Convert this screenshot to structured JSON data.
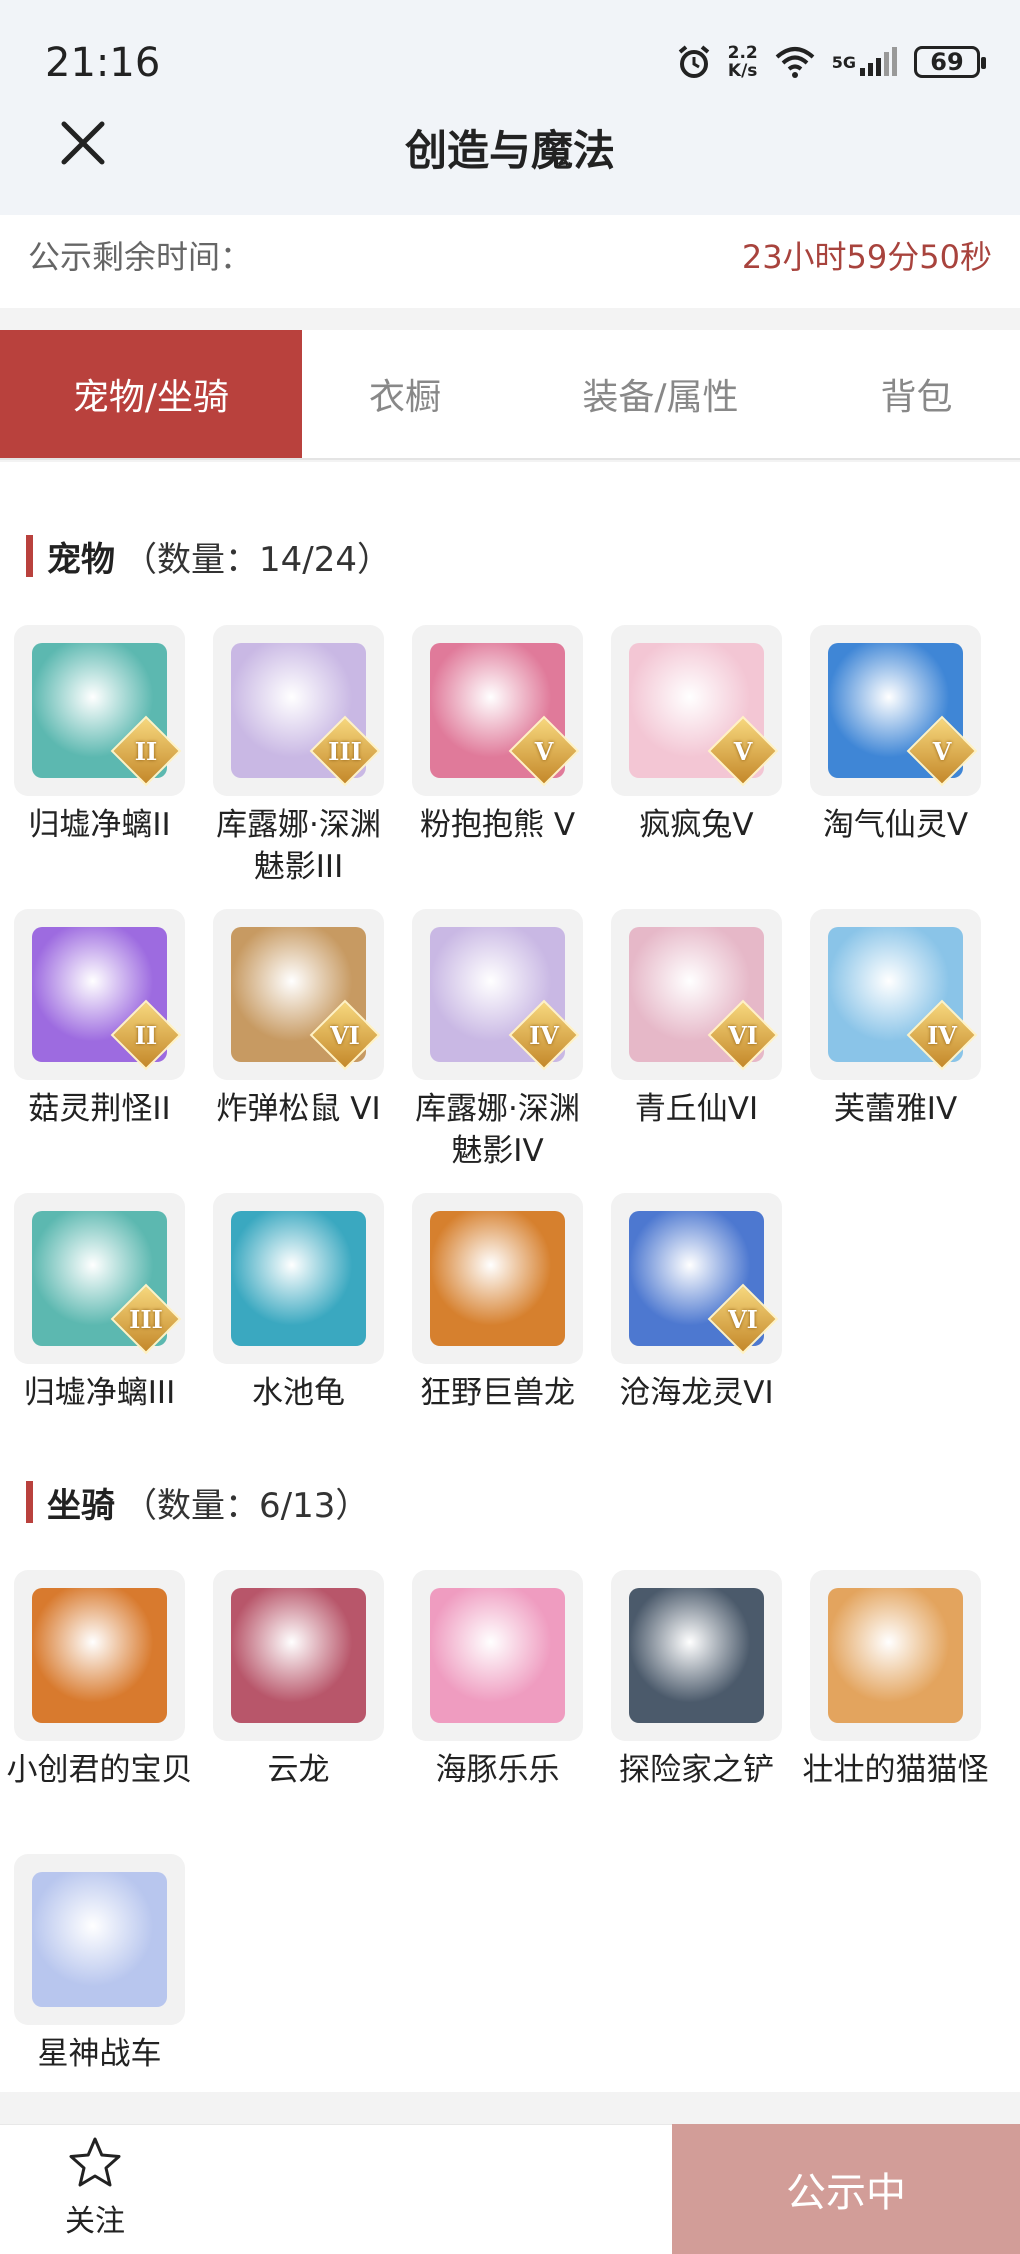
{
  "status_bar": {
    "time": "21:16",
    "net_speed_value": "2.2",
    "net_speed_unit": "K/s",
    "network": "5G",
    "battery": "69"
  },
  "header": {
    "title": "创造与魔法"
  },
  "notice": {
    "label": "公示剩余时间：",
    "remaining": "23小时59分50秒"
  },
  "tabs": [
    {
      "label": "宠物/坐骑",
      "active": true
    },
    {
      "label": "衣橱",
      "active": false
    },
    {
      "label": "装备/属性",
      "active": false
    },
    {
      "label": "背包",
      "active": false
    }
  ],
  "pets": {
    "title": "宠物",
    "count": "（数量：14/24）",
    "items": [
      {
        "name": "归墟净螭II",
        "rank": "II",
        "color": "#5cb8b0"
      },
      {
        "name": "库露娜·深渊魅影III",
        "rank": "III",
        "color": "#c9b8e4"
      },
      {
        "name": "粉抱抱熊 V",
        "rank": "V",
        "color": "#e07a9a"
      },
      {
        "name": "疯疯兔V",
        "rank": "V",
        "color": "#f3c6d4"
      },
      {
        "name": "淘气仙灵V",
        "rank": "V",
        "color": "#3f86d6"
      },
      {
        "name": "菇灵荆怪II",
        "rank": "II",
        "color": "#9d6be0"
      },
      {
        "name": "炸弹松鼠 VI",
        "rank": "VI",
        "color": "#c79a62"
      },
      {
        "name": "库露娜·深渊魅影IV",
        "rank": "IV",
        "color": "#c9b8e4"
      },
      {
        "name": "青丘仙VI",
        "rank": "VI",
        "color": "#e6b8c8"
      },
      {
        "name": "芙蕾雅IV",
        "rank": "IV",
        "color": "#8ac4e8"
      },
      {
        "name": "归墟净螭III",
        "rank": "III",
        "color": "#5cb8b0"
      },
      {
        "name": "水池龟",
        "rank": "",
        "color": "#3aa8c0"
      },
      {
        "name": "狂野巨兽龙",
        "rank": "",
        "color": "#d6802e"
      },
      {
        "name": "沧海龙灵VI",
        "rank": "VI",
        "color": "#4d78d0"
      }
    ]
  },
  "mounts": {
    "title": "坐骑",
    "count": "（数量：6/13）",
    "items": [
      {
        "name": "小创君的宝贝",
        "color": "#d87a2e"
      },
      {
        "name": "云龙",
        "color": "#b8566a"
      },
      {
        "name": "海豚乐乐",
        "color": "#ef9cc0"
      },
      {
        "name": "探险家之铲",
        "color": "#4b5a6b"
      },
      {
        "name": "壮壮的猫猫怪",
        "color": "#e3a45e"
      },
      {
        "name": "星神战车",
        "color": "#b8c6ee"
      }
    ]
  },
  "bottom": {
    "follow_label": "关注",
    "publish_label": "公示中"
  }
}
